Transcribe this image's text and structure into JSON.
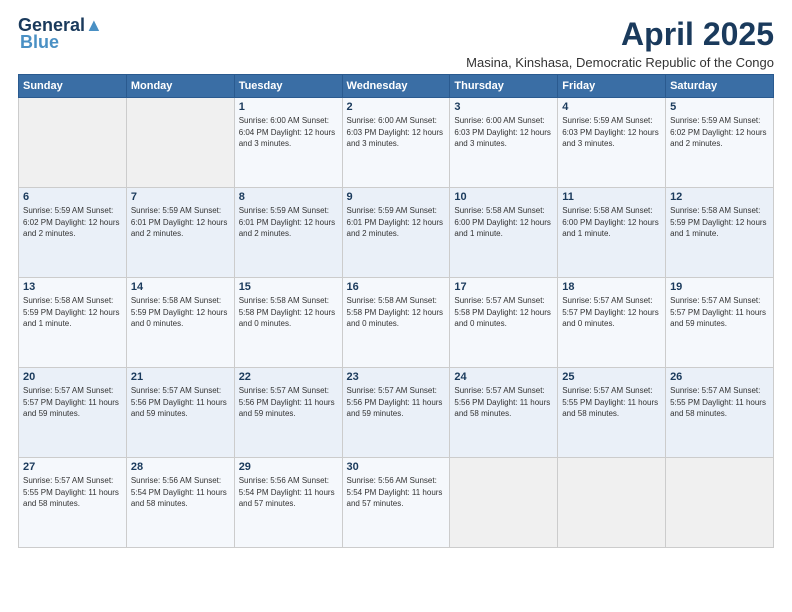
{
  "logo": {
    "line1": "General",
    "line2": "Blue"
  },
  "title": "April 2025",
  "subtitle": "Masina, Kinshasa, Democratic Republic of the Congo",
  "headers": [
    "Sunday",
    "Monday",
    "Tuesday",
    "Wednesday",
    "Thursday",
    "Friday",
    "Saturday"
  ],
  "weeks": [
    [
      {
        "day": "",
        "info": ""
      },
      {
        "day": "",
        "info": ""
      },
      {
        "day": "1",
        "info": "Sunrise: 6:00 AM\nSunset: 6:04 PM\nDaylight: 12 hours\nand 3 minutes."
      },
      {
        "day": "2",
        "info": "Sunrise: 6:00 AM\nSunset: 6:03 PM\nDaylight: 12 hours\nand 3 minutes."
      },
      {
        "day": "3",
        "info": "Sunrise: 6:00 AM\nSunset: 6:03 PM\nDaylight: 12 hours\nand 3 minutes."
      },
      {
        "day": "4",
        "info": "Sunrise: 5:59 AM\nSunset: 6:03 PM\nDaylight: 12 hours\nand 3 minutes."
      },
      {
        "day": "5",
        "info": "Sunrise: 5:59 AM\nSunset: 6:02 PM\nDaylight: 12 hours\nand 2 minutes."
      }
    ],
    [
      {
        "day": "6",
        "info": "Sunrise: 5:59 AM\nSunset: 6:02 PM\nDaylight: 12 hours\nand 2 minutes."
      },
      {
        "day": "7",
        "info": "Sunrise: 5:59 AM\nSunset: 6:01 PM\nDaylight: 12 hours\nand 2 minutes."
      },
      {
        "day": "8",
        "info": "Sunrise: 5:59 AM\nSunset: 6:01 PM\nDaylight: 12 hours\nand 2 minutes."
      },
      {
        "day": "9",
        "info": "Sunrise: 5:59 AM\nSunset: 6:01 PM\nDaylight: 12 hours\nand 2 minutes."
      },
      {
        "day": "10",
        "info": "Sunrise: 5:58 AM\nSunset: 6:00 PM\nDaylight: 12 hours\nand 1 minute."
      },
      {
        "day": "11",
        "info": "Sunrise: 5:58 AM\nSunset: 6:00 PM\nDaylight: 12 hours\nand 1 minute."
      },
      {
        "day": "12",
        "info": "Sunrise: 5:58 AM\nSunset: 5:59 PM\nDaylight: 12 hours\nand 1 minute."
      }
    ],
    [
      {
        "day": "13",
        "info": "Sunrise: 5:58 AM\nSunset: 5:59 PM\nDaylight: 12 hours\nand 1 minute."
      },
      {
        "day": "14",
        "info": "Sunrise: 5:58 AM\nSunset: 5:59 PM\nDaylight: 12 hours\nand 0 minutes."
      },
      {
        "day": "15",
        "info": "Sunrise: 5:58 AM\nSunset: 5:58 PM\nDaylight: 12 hours\nand 0 minutes."
      },
      {
        "day": "16",
        "info": "Sunrise: 5:58 AM\nSunset: 5:58 PM\nDaylight: 12 hours\nand 0 minutes."
      },
      {
        "day": "17",
        "info": "Sunrise: 5:57 AM\nSunset: 5:58 PM\nDaylight: 12 hours\nand 0 minutes."
      },
      {
        "day": "18",
        "info": "Sunrise: 5:57 AM\nSunset: 5:57 PM\nDaylight: 12 hours\nand 0 minutes."
      },
      {
        "day": "19",
        "info": "Sunrise: 5:57 AM\nSunset: 5:57 PM\nDaylight: 11 hours\nand 59 minutes."
      }
    ],
    [
      {
        "day": "20",
        "info": "Sunrise: 5:57 AM\nSunset: 5:57 PM\nDaylight: 11 hours\nand 59 minutes."
      },
      {
        "day": "21",
        "info": "Sunrise: 5:57 AM\nSunset: 5:56 PM\nDaylight: 11 hours\nand 59 minutes."
      },
      {
        "day": "22",
        "info": "Sunrise: 5:57 AM\nSunset: 5:56 PM\nDaylight: 11 hours\nand 59 minutes."
      },
      {
        "day": "23",
        "info": "Sunrise: 5:57 AM\nSunset: 5:56 PM\nDaylight: 11 hours\nand 59 minutes."
      },
      {
        "day": "24",
        "info": "Sunrise: 5:57 AM\nSunset: 5:56 PM\nDaylight: 11 hours\nand 58 minutes."
      },
      {
        "day": "25",
        "info": "Sunrise: 5:57 AM\nSunset: 5:55 PM\nDaylight: 11 hours\nand 58 minutes."
      },
      {
        "day": "26",
        "info": "Sunrise: 5:57 AM\nSunset: 5:55 PM\nDaylight: 11 hours\nand 58 minutes."
      }
    ],
    [
      {
        "day": "27",
        "info": "Sunrise: 5:57 AM\nSunset: 5:55 PM\nDaylight: 11 hours\nand 58 minutes."
      },
      {
        "day": "28",
        "info": "Sunrise: 5:56 AM\nSunset: 5:54 PM\nDaylight: 11 hours\nand 58 minutes."
      },
      {
        "day": "29",
        "info": "Sunrise: 5:56 AM\nSunset: 5:54 PM\nDaylight: 11 hours\nand 57 minutes."
      },
      {
        "day": "30",
        "info": "Sunrise: 5:56 AM\nSunset: 5:54 PM\nDaylight: 11 hours\nand 57 minutes."
      },
      {
        "day": "",
        "info": ""
      },
      {
        "day": "",
        "info": ""
      },
      {
        "day": "",
        "info": ""
      }
    ]
  ]
}
